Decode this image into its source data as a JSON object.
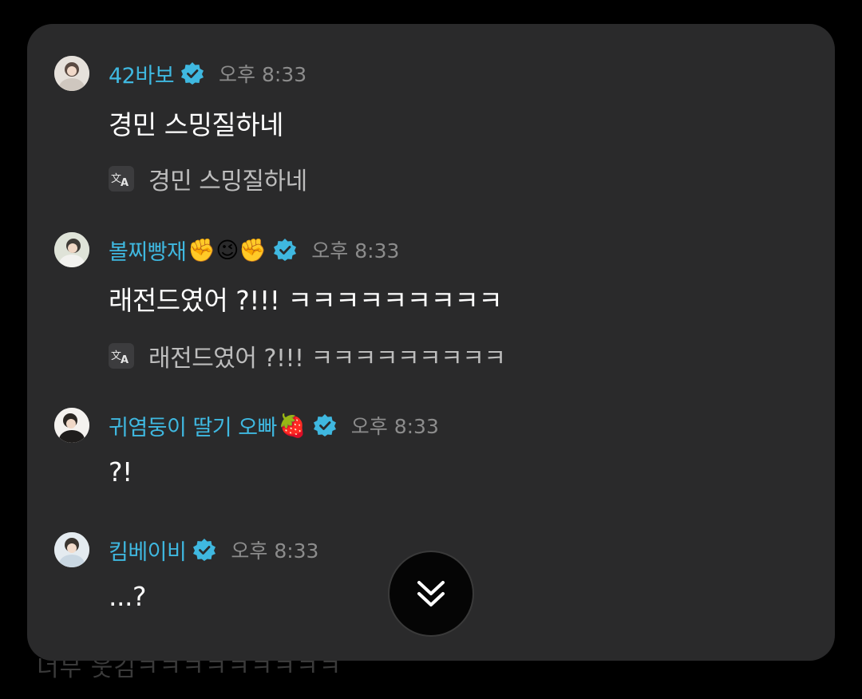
{
  "background_text": "너무 웃김ㅋㅋㅋㅋㅋㅋㅋㅋㅋ",
  "colors": {
    "panel": "#2a2a2b",
    "name": "#3fb8e0",
    "verified": "#3fb8e0",
    "time": "#8c8c8c",
    "text": "#ffffff",
    "translation": "#bdbdbd"
  },
  "messages": [
    {
      "author": "42바보",
      "emoji": "",
      "time": "오후 8:33",
      "text": "경민 스밍질하네",
      "translation": "경민 스밍질하네",
      "verified_icon": "verified-badge-icon",
      "translate_icon": "translate-icon"
    },
    {
      "author": "볼찌빵재",
      "emoji": "✊😉✊",
      "time": "오후 8:33",
      "text": "래전드였어 ?!!! ㅋㅋㅋㅋㅋㅋㅋㅋㅋ",
      "translation": "래전드였어 ?!!! ㅋㅋㅋㅋㅋㅋㅋㅋㅋ",
      "verified_icon": "verified-badge-icon",
      "translate_icon": "translate-icon"
    },
    {
      "author": "귀염둥이 딸기 오빠",
      "emoji": "🍓",
      "time": "오후 8:33",
      "text": "?!",
      "verified_icon": "verified-badge-icon"
    },
    {
      "author": "킴베이비",
      "emoji": "",
      "time": "오후 8:33",
      "text": "...?",
      "verified_icon": "verified-badge-icon"
    }
  ],
  "scroll_button": {
    "icon": "double-chevron-down-icon"
  }
}
